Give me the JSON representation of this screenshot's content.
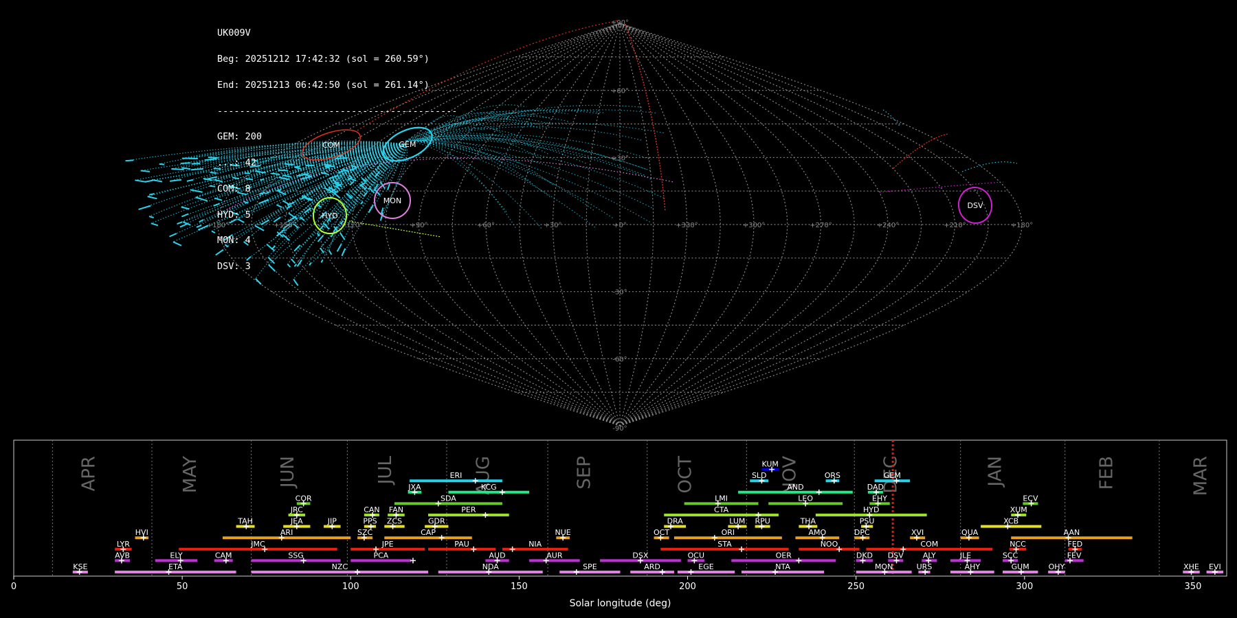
{
  "info": {
    "camera": "UK009V",
    "begin": "Beg: 20251212 17:42:32 (sol = 260.59°)",
    "end": "End: 20251213 06:42:50 (sol = 261.14°)",
    "separator": "-------------------------------------------",
    "counts": [
      "GEM: 200",
      "...: 42",
      "COM: 8",
      "HYD: 5",
      "MON: 4",
      "DSV: 3"
    ]
  },
  "sky_map": {
    "projection": "sinusoidal",
    "lon_ticks": [
      "+180°",
      "+150°",
      "+120°",
      "+90°",
      "+60°",
      "+30°",
      "+0°",
      "+330°",
      "+300°",
      "+270°",
      "+240°",
      "+210°",
      "+180°"
    ],
    "lat_ticks": [
      "+90°",
      "+60°",
      "+30°",
      "-30°",
      "-60°",
      "-90°"
    ],
    "radiants": [
      {
        "code": "COM",
        "color": "#e03020"
      },
      {
        "code": "GEM",
        "color": "#29d3ee"
      },
      {
        "code": "MON",
        "color": "#e080e0"
      },
      {
        "code": "HYD",
        "color": "#b2ff2e"
      },
      {
        "code": "DSV",
        "color": "#d020d0"
      }
    ]
  },
  "chart_data": {
    "type": "timeline",
    "xlabel": "Solar longitude (deg)",
    "xlim": [
      0,
      360
    ],
    "xticks": [
      0,
      50,
      100,
      150,
      200,
      250,
      300,
      350
    ],
    "current_sol": 260.9,
    "months": [
      {
        "name": "APR",
        "start": 11.5,
        "label": 24
      },
      {
        "name": "MAY",
        "start": 41,
        "label": 54
      },
      {
        "name": "JUN",
        "start": 70.5,
        "label": 83
      },
      {
        "name": "JUL",
        "start": 99,
        "label": 112
      },
      {
        "name": "AUG",
        "start": 128.5,
        "label": 141
      },
      {
        "name": "SEP",
        "start": 158.5,
        "label": 171
      },
      {
        "name": "OCT",
        "start": 188,
        "label": 201
      },
      {
        "name": "NOV",
        "start": 217.5,
        "label": 232
      },
      {
        "name": "DEC",
        "start": 249.5,
        "label": 262
      },
      {
        "name": "JAN",
        "start": 281,
        "label": 293
      },
      {
        "name": "FEB",
        "start": 312,
        "label": 326
      },
      {
        "name": "MAR",
        "start": 340,
        "label": 354
      }
    ],
    "showers": [
      {
        "code": "KUM",
        "row": 9,
        "start": 222,
        "end": 227,
        "peak": 225,
        "color": "#0000dd"
      },
      {
        "code": "ERI",
        "row": 8,
        "start": 117.5,
        "end": 145,
        "peak": 137,
        "color": "#22d3ee"
      },
      {
        "code": "SLD",
        "row": 8,
        "start": 218.5,
        "end": 224,
        "peak": 222,
        "color": "#22d3ee"
      },
      {
        "code": "ORS",
        "row": 8,
        "start": 241,
        "end": 245,
        "peak": 243.5,
        "color": "#22d3ee"
      },
      {
        "code": "GEM",
        "row": 8,
        "start": 255.5,
        "end": 266,
        "peak": 262,
        "color": "#22d3ee"
      },
      {
        "code": "JXA",
        "row": 7,
        "start": 117,
        "end": 121,
        "peak": 119,
        "color": "#22e888"
      },
      {
        "code": "KCG",
        "row": 7,
        "start": 129,
        "end": 153,
        "peak": 145,
        "color": "#22e888"
      },
      {
        "code": "AND",
        "row": 7,
        "start": 215,
        "end": 249,
        "peak": 239,
        "color": "#22e888"
      },
      {
        "code": "DAD",
        "row": 7,
        "start": 253.5,
        "end": 258,
        "peak": 256,
        "color": "#22e888"
      },
      {
        "code": "COR",
        "row": 6,
        "start": 84,
        "end": 88,
        "peak": 86,
        "color": "#6ac72a"
      },
      {
        "code": "SDA",
        "row": 6,
        "start": 113,
        "end": 145,
        "peak": 126,
        "color": "#6ac72a"
      },
      {
        "code": "LMI",
        "row": 6,
        "start": 199,
        "end": 221,
        "peak": 209,
        "color": "#6ac72a"
      },
      {
        "code": "LEO",
        "row": 6,
        "start": 224,
        "end": 246,
        "peak": 235,
        "color": "#6ac72a"
      },
      {
        "code": "EHY",
        "row": 6,
        "start": 254,
        "end": 260,
        "peak": 256.5,
        "color": "#6ac72a"
      },
      {
        "code": "ECV",
        "row": 6,
        "start": 299.5,
        "end": 304,
        "peak": 302,
        "color": "#6ac72a"
      },
      {
        "code": "JRC",
        "row": 5,
        "start": 81.5,
        "end": 86.5,
        "peak": 84,
        "color": "#9bde2c"
      },
      {
        "code": "CAN",
        "row": 5,
        "start": 104,
        "end": 108.5,
        "peak": 106.5,
        "color": "#9bde2c"
      },
      {
        "code": "FAN",
        "row": 5,
        "start": 111,
        "end": 116,
        "peak": 113.5,
        "color": "#9bde2c"
      },
      {
        "code": "PER",
        "row": 5,
        "start": 123,
        "end": 147,
        "peak": 140,
        "color": "#9bde2c"
      },
      {
        "code": "CTA",
        "row": 5,
        "start": 193,
        "end": 227,
        "peak": 221,
        "color": "#9bde2c"
      },
      {
        "code": "HYD",
        "row": 5,
        "start": 238,
        "end": 271,
        "peak": 254,
        "color": "#9bde2c"
      },
      {
        "code": "XUM",
        "row": 5,
        "start": 296,
        "end": 300.5,
        "peak": 298,
        "color": "#9bde2c"
      },
      {
        "code": "TAH",
        "row": 4,
        "start": 66,
        "end": 71.5,
        "peak": 69,
        "color": "#e7e020"
      },
      {
        "code": "JEA",
        "row": 4,
        "start": 80,
        "end": 88,
        "peak": 84,
        "color": "#e7e020"
      },
      {
        "code": "JIP",
        "row": 4,
        "start": 92,
        "end": 97,
        "peak": 94.5,
        "color": "#e7e020"
      },
      {
        "code": "PPS",
        "row": 4,
        "start": 104,
        "end": 107.5,
        "peak": 106,
        "color": "#e7e020"
      },
      {
        "code": "ZCS",
        "row": 4,
        "start": 110,
        "end": 116,
        "peak": 112.5,
        "color": "#e7e020"
      },
      {
        "code": "GDR",
        "row": 4,
        "start": 122,
        "end": 129,
        "peak": 125,
        "color": "#e7e020"
      },
      {
        "code": "DRA",
        "row": 4,
        "start": 193,
        "end": 199.5,
        "peak": 195,
        "color": "#e7e020"
      },
      {
        "code": "LUM",
        "row": 4,
        "start": 212,
        "end": 217.5,
        "peak": 215,
        "color": "#e7e020"
      },
      {
        "code": "RPU",
        "row": 4,
        "start": 220,
        "end": 224.5,
        "peak": 222,
        "color": "#e7e020"
      },
      {
        "code": "THA",
        "row": 4,
        "start": 233,
        "end": 238.5,
        "peak": 236,
        "color": "#e7e020"
      },
      {
        "code": "PSU",
        "row": 4,
        "start": 251.5,
        "end": 255,
        "peak": 253,
        "color": "#e7e020"
      },
      {
        "code": "XCB",
        "row": 4,
        "start": 287,
        "end": 305,
        "peak": 295,
        "color": "#e7e020"
      },
      {
        "code": "HVI",
        "row": 3,
        "start": 36,
        "end": 40,
        "peak": 38.5,
        "color": "#e8a020"
      },
      {
        "code": "ARI",
        "row": 3,
        "start": 62,
        "end": 100,
        "peak": 79.5,
        "color": "#e8a020"
      },
      {
        "code": "SZC",
        "row": 3,
        "start": 102,
        "end": 106.5,
        "peak": 104,
        "color": "#e8a020"
      },
      {
        "code": "CAP",
        "row": 3,
        "start": 110,
        "end": 136,
        "peak": 127,
        "color": "#e8a020"
      },
      {
        "code": "NUE",
        "row": 3,
        "start": 161,
        "end": 165,
        "peak": 163,
        "color": "#e8a020"
      },
      {
        "code": "OCT",
        "row": 3,
        "start": 190,
        "end": 194.5,
        "peak": 192,
        "color": "#e8a020"
      },
      {
        "code": "ORI",
        "row": 3,
        "start": 196,
        "end": 228,
        "peak": 208,
        "color": "#e8a020"
      },
      {
        "code": "AMO",
        "row": 3,
        "start": 232,
        "end": 245,
        "peak": 240,
        "color": "#e8a020"
      },
      {
        "code": "DPC",
        "row": 3,
        "start": 249.5,
        "end": 254,
        "peak": 252,
        "color": "#e8a020"
      },
      {
        "code": "XVI",
        "row": 3,
        "start": 266,
        "end": 270.5,
        "peak": 268,
        "color": "#e8a020"
      },
      {
        "code": "QUA",
        "row": 3,
        "start": 281,
        "end": 286.5,
        "peak": 283.5,
        "color": "#e8a020"
      },
      {
        "code": "AAN",
        "row": 3,
        "start": 296,
        "end": 332,
        "peak": 313,
        "color": "#e8a020"
      },
      {
        "code": "LYR",
        "row": 2,
        "start": 30,
        "end": 35,
        "peak": 32.5,
        "color": "#e82010"
      },
      {
        "code": "JMC",
        "row": 2,
        "start": 49,
        "end": 96,
        "peak": 74.5,
        "color": "#e82010"
      },
      {
        "code": "JPE",
        "row": 2,
        "start": 100,
        "end": 122,
        "peak": 107.5,
        "color": "#e82010"
      },
      {
        "code": "PAU",
        "row": 2,
        "start": 123,
        "end": 143,
        "peak": 136.5,
        "color": "#e82010"
      },
      {
        "code": "NIA",
        "row": 2,
        "start": 145,
        "end": 164.5,
        "peak": 148,
        "color": "#e82010"
      },
      {
        "code": "STA",
        "row": 2,
        "start": 192,
        "end": 230,
        "peak": 216,
        "color": "#e82010"
      },
      {
        "code": "NOO",
        "row": 2,
        "start": 233,
        "end": 251,
        "peak": 245,
        "color": "#e82010"
      },
      {
        "code": "COM",
        "row": 2,
        "start": 253,
        "end": 290.5,
        "peak": 264,
        "color": "#e82010"
      },
      {
        "code": "NCC",
        "row": 2,
        "start": 295.5,
        "end": 300.5,
        "peak": 297.5,
        "color": "#e82010"
      },
      {
        "code": "FED",
        "row": 2,
        "start": 313,
        "end": 317,
        "peak": 315,
        "color": "#e82010"
      },
      {
        "code": "AVB",
        "row": 1,
        "start": 30,
        "end": 34.5,
        "peak": 32,
        "color": "#c030d8"
      },
      {
        "code": "ELY",
        "row": 1,
        "start": 42,
        "end": 54.5,
        "peak": 49.5,
        "color": "#c030d8"
      },
      {
        "code": "CAM",
        "row": 1,
        "start": 59.5,
        "end": 65,
        "peak": 63,
        "color": "#c030d8"
      },
      {
        "code": "SSG",
        "row": 1,
        "start": 70.5,
        "end": 97,
        "peak": 86,
        "color": "#c030d8"
      },
      {
        "code": "PCA",
        "row": 1,
        "start": 100,
        "end": 118,
        "peak": 118.5,
        "color": "#c030d8"
      },
      {
        "code": "AUD",
        "row": 1,
        "start": 140,
        "end": 147,
        "peak": 143.5,
        "color": "#c030d8"
      },
      {
        "code": "AUR",
        "row": 1,
        "start": 153,
        "end": 168,
        "peak": 158,
        "color": "#c030d8"
      },
      {
        "code": "DSX",
        "row": 1,
        "start": 174,
        "end": 198,
        "peak": 186,
        "color": "#c030d8"
      },
      {
        "code": "OCU",
        "row": 1,
        "start": 200,
        "end": 205,
        "peak": 202,
        "color": "#c030d8"
      },
      {
        "code": "OER",
        "row": 1,
        "start": 213,
        "end": 244,
        "peak": 233,
        "color": "#c030d8"
      },
      {
        "code": "DKD",
        "row": 1,
        "start": 250,
        "end": 255,
        "peak": 252,
        "color": "#c030d8"
      },
      {
        "code": "DSV",
        "row": 1,
        "start": 259.5,
        "end": 264,
        "peak": 262,
        "color": "#c030d8"
      },
      {
        "code": "ALY",
        "row": 1,
        "start": 269.5,
        "end": 274,
        "peak": 271.5,
        "color": "#c030d8"
      },
      {
        "code": "JLE",
        "row": 1,
        "start": 278,
        "end": 287,
        "peak": 283,
        "color": "#c030d8"
      },
      {
        "code": "SCC",
        "row": 1,
        "start": 293.5,
        "end": 298,
        "peak": 296,
        "color": "#c030d8"
      },
      {
        "code": "FEV",
        "row": 1,
        "start": 312,
        "end": 317.5,
        "peak": 313.5,
        "color": "#c030d8"
      },
      {
        "code": "KSE",
        "row": 0,
        "start": 17.5,
        "end": 22,
        "peak": 19.5,
        "color": "#e080e0"
      },
      {
        "code": "ETA",
        "row": 0,
        "start": 30,
        "end": 66,
        "peak": 46,
        "color": "#e080e0"
      },
      {
        "code": "NZC",
        "row": 0,
        "start": 70.5,
        "end": 123,
        "peak": 102,
        "color": "#e080e0"
      },
      {
        "code": "NDA",
        "row": 0,
        "start": 126,
        "end": 157,
        "peak": 141,
        "color": "#e080e0"
      },
      {
        "code": "SPE",
        "row": 0,
        "start": 162,
        "end": 180,
        "peak": 167,
        "color": "#e080e0"
      },
      {
        "code": "ARD",
        "row": 0,
        "start": 183,
        "end": 196,
        "peak": 192.5,
        "color": "#e080e0"
      },
      {
        "code": "EGE",
        "row": 0,
        "start": 197,
        "end": 214,
        "peak": 201,
        "color": "#e080e0"
      },
      {
        "code": "NTA",
        "row": 0,
        "start": 216,
        "end": 240.5,
        "peak": 226,
        "color": "#e080e0"
      },
      {
        "code": "MON",
        "row": 0,
        "start": 250,
        "end": 266.5,
        "peak": 258.5,
        "color": "#e080e0"
      },
      {
        "code": "URS",
        "row": 0,
        "start": 268.5,
        "end": 272,
        "peak": 270.5,
        "color": "#e080e0"
      },
      {
        "code": "AHY",
        "row": 0,
        "start": 278,
        "end": 291,
        "peak": 284,
        "color": "#e080e0"
      },
      {
        "code": "GUM",
        "row": 0,
        "start": 293.5,
        "end": 304,
        "peak": 299,
        "color": "#e080e0"
      },
      {
        "code": "OHY",
        "row": 0,
        "start": 307,
        "end": 312,
        "peak": 310,
        "color": "#e080e0"
      },
      {
        "code": "XHE",
        "row": 0,
        "start": 347,
        "end": 352,
        "peak": 349.5,
        "color": "#e080e0"
      },
      {
        "code": "EVI",
        "row": 0,
        "start": 354,
        "end": 359,
        "peak": 356.5,
        "color": "#e080e0"
      }
    ]
  }
}
